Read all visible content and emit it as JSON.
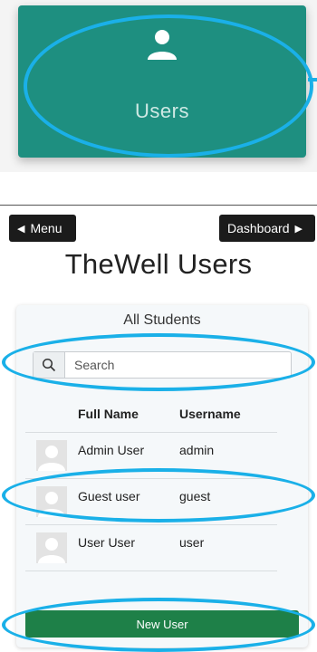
{
  "tile": {
    "label": "Users"
  },
  "nav": {
    "menu_label": "Menu",
    "dashboard_label": "Dashboard"
  },
  "page": {
    "title": "TheWell Users"
  },
  "panel": {
    "title": "All Students",
    "search_placeholder": "Search",
    "columns": {
      "full_name": "Full Name",
      "username": "Username"
    },
    "rows": [
      {
        "full_name": "Admin User",
        "username": "admin"
      },
      {
        "full_name": "Guest user",
        "username": "guest"
      },
      {
        "full_name": "User User",
        "username": "user"
      }
    ],
    "new_user_label": "New User"
  },
  "colors": {
    "tile": "#1e8f80",
    "primary_button": "#1e8048",
    "annotation": "#1ab0e8",
    "nav_button": "#1b1b1b"
  }
}
